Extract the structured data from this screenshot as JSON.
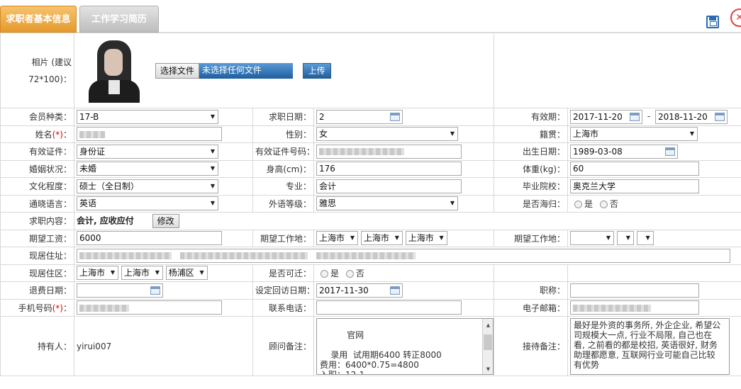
{
  "tabs": [
    {
      "label": "求职者基本信息",
      "active": true
    },
    {
      "label": "工作学习简历",
      "active": false
    }
  ],
  "photo": {
    "label": "相片 (建议72*100)：",
    "choose_file": "选择文件",
    "no_file": "未选择任何文件",
    "upload": "上传"
  },
  "member_type": {
    "label": "会员种类：",
    "value": "17-B"
  },
  "apply_date": {
    "label": "求职日期：",
    "value": "2"
  },
  "valid_period": {
    "label": "有效期：",
    "from": "2017-11-20",
    "dash": "-",
    "to": "2018-11-20"
  },
  "name": {
    "label": "姓名",
    "req": "(*)",
    "colon": "："
  },
  "gender": {
    "label": "性别：",
    "value": "女"
  },
  "native": {
    "label": "籍贯：",
    "value": "上海市"
  },
  "id_type": {
    "label": "有效证件：",
    "value": "身份证"
  },
  "id_no": {
    "label": "有效证件号码："
  },
  "birth": {
    "label": "出生日期：",
    "value": "1989-03-08"
  },
  "marital": {
    "label": "婚姻状况：",
    "value": "未婚"
  },
  "height": {
    "label": "身高(cm)：",
    "value": "176"
  },
  "weight": {
    "label": "体重(kg)：",
    "value": "60"
  },
  "education": {
    "label": "文化程度：",
    "value": "硕士（全日制）"
  },
  "major": {
    "label": "专业：",
    "value": "会计"
  },
  "school": {
    "label": "毕业院校：",
    "value": "奥克兰大学"
  },
  "language": {
    "label": "通晓语言：",
    "value": "英语"
  },
  "lang_level": {
    "label": "外语等级：",
    "value": "雅思"
  },
  "overseas": {
    "label": "是否海归：",
    "yes": "是",
    "no": "否"
  },
  "job_content": {
    "label": "求职内容：",
    "value": "会计, 应收应付",
    "edit": "修改"
  },
  "salary": {
    "label": "期望工资：",
    "value": "6000"
  },
  "work_place": {
    "label": "期望工作地：",
    "p1": "上海市",
    "p2": "上海市",
    "p3": "上海市"
  },
  "work_place2": {
    "label": "期望工作地："
  },
  "address": {
    "label": "现居住址："
  },
  "district": {
    "label": "现居住区：",
    "p1": "上海市",
    "p2": "上海市",
    "p3": "杨浦区"
  },
  "relocate": {
    "label": "是否可迁：",
    "yes": "是",
    "no": "否"
  },
  "refund_date": {
    "label": "退费日期："
  },
  "followup_date": {
    "label": "设定回访日期：",
    "value": "2017-11-30"
  },
  "title": {
    "label": "职称："
  },
  "mobile": {
    "label": "手机号码",
    "req": "(*)",
    "colon": "："
  },
  "phone": {
    "label": "联系电话："
  },
  "email": {
    "label": "电子邮箱："
  },
  "owner": {
    "label": "持有人：",
    "value": "yirui007"
  },
  "advisor_note": {
    "label": "顾问备注：",
    "value": "官网\n\n    录用  试用期6400 转正8000\n费用：6400*0.75=4800\n入职：12-1"
  },
  "reception_note": {
    "label": "接待备注：",
    "value": " 最好是外资的事务所, 外企企业, 希望公司规模大一点, 行业不局限, 自己也在看, 之前看的都是校招, 英语很好, 财务助理都愿意, 互联网行业可能自己比较有优势"
  }
}
